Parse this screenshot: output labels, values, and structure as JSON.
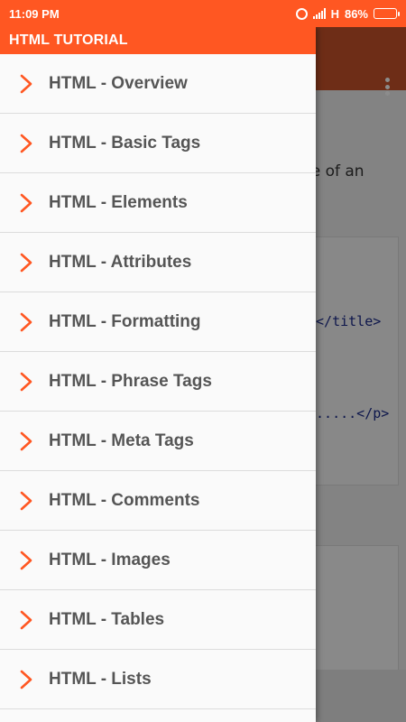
{
  "status_bar": {
    "time": "11:09 PM",
    "network": "H",
    "battery_percent": "86%",
    "battery_level": 0.86
  },
  "drawer": {
    "title": "HTML TUTORIAL",
    "items": [
      {
        "label": "HTML - Overview"
      },
      {
        "label": "HTML - Basic Tags"
      },
      {
        "label": "HTML - Elements"
      },
      {
        "label": "HTML - Attributes"
      },
      {
        "label": "HTML - Formatting"
      },
      {
        "label": "HTML - Phrase Tags"
      },
      {
        "label": "HTML - Meta Tags"
      },
      {
        "label": "HTML - Comments"
      },
      {
        "label": "HTML - Images"
      },
      {
        "label": "HTML - Tables"
      },
      {
        "label": "HTML - Lists"
      }
    ]
  },
  "background_content": {
    "text_fragment": "le of an",
    "code_line_1": "e</title>",
    "code_line_2": "e.....</p>"
  },
  "colors": {
    "accent": "#ff5722",
    "toolbar_dimmed": "#c8532a",
    "item_text": "#555555",
    "chevron": "#ff5722",
    "code_text": "#1b2a8a"
  },
  "icons": {
    "item_icon": "chevron-right-icon",
    "overflow_menu": "more-vert-icon",
    "alarm": "alarm-icon",
    "signal": "signal-icon",
    "battery": "battery-icon"
  }
}
